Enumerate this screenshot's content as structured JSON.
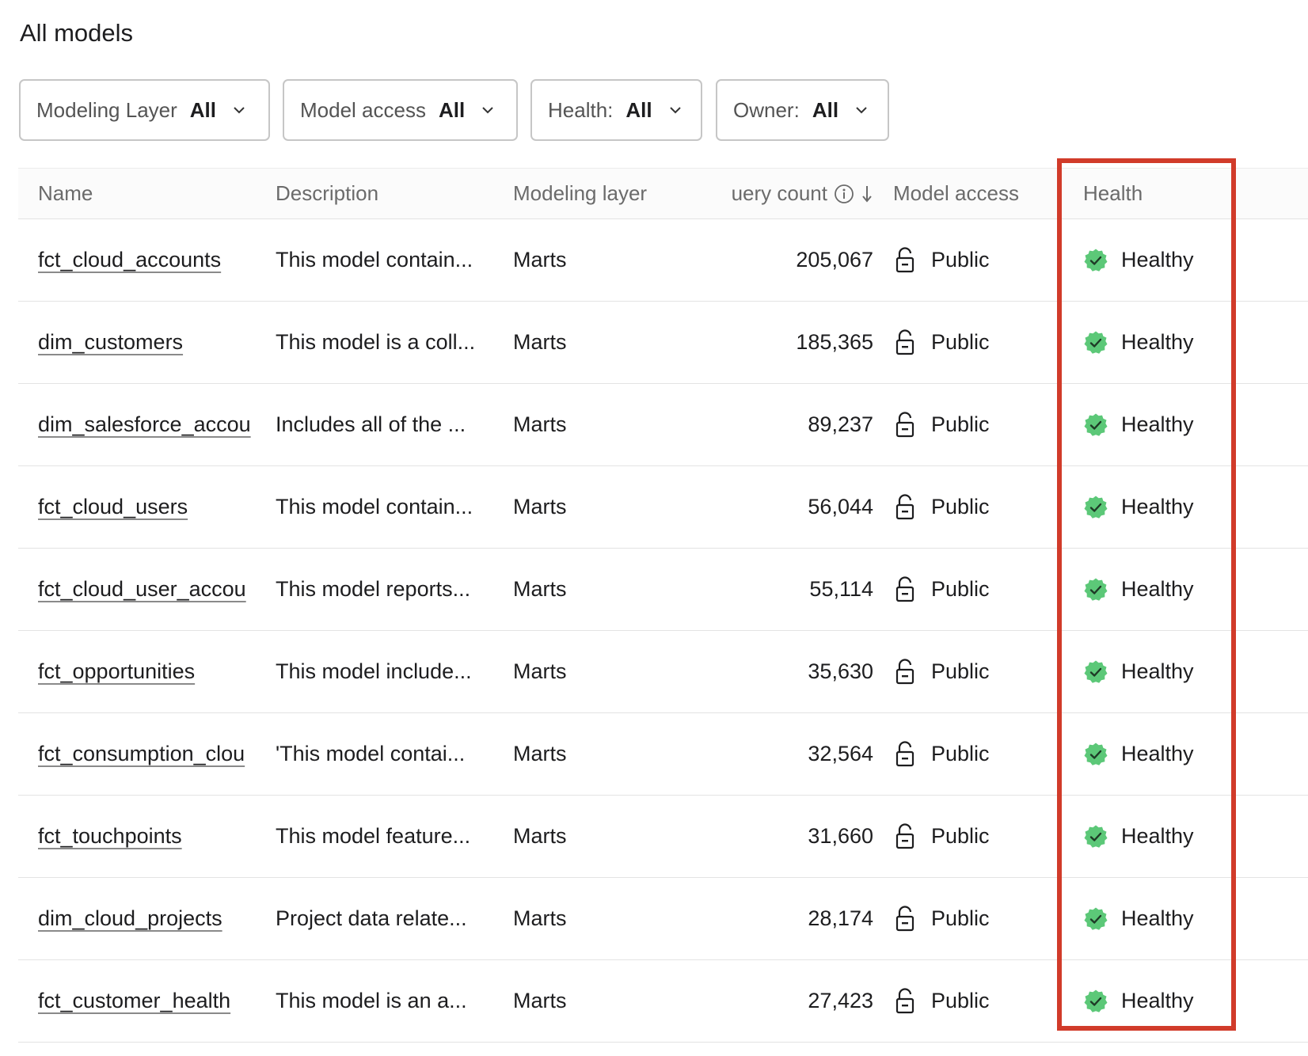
{
  "page": {
    "title": "All models"
  },
  "filters": [
    {
      "label": "Modeling Layer",
      "value": "All"
    },
    {
      "label": "Model access",
      "value": "All"
    },
    {
      "label": "Health:",
      "value": "All"
    },
    {
      "label": "Owner:",
      "value": "All"
    }
  ],
  "table": {
    "columns": {
      "name": "Name",
      "description": "Description",
      "modeling_layer": "Modeling layer",
      "query_count": "Query count",
      "model_access": "Model access",
      "health": "Health"
    },
    "rows": [
      {
        "name": "fct_cloud_accounts",
        "description": "This model contain...",
        "layer": "Marts",
        "count": "205,067",
        "access": "Public",
        "health": "Healthy"
      },
      {
        "name": "dim_customers",
        "description": "This model is a coll...",
        "layer": "Marts",
        "count": "185,365",
        "access": "Public",
        "health": "Healthy"
      },
      {
        "name": "dim_salesforce_accou",
        "description": "Includes all of the ...",
        "layer": "Marts",
        "count": "89,237",
        "access": "Public",
        "health": "Healthy"
      },
      {
        "name": "fct_cloud_users",
        "description": "This model contain...",
        "layer": "Marts",
        "count": "56,044",
        "access": "Public",
        "health": "Healthy"
      },
      {
        "name": "fct_cloud_user_accou",
        "description": "This model reports...",
        "layer": "Marts",
        "count": "55,114",
        "access": "Public",
        "health": "Healthy"
      },
      {
        "name": "fct_opportunities",
        "description": "This model include...",
        "layer": "Marts",
        "count": "35,630",
        "access": "Public",
        "health": "Healthy"
      },
      {
        "name": "fct_consumption_clou",
        "description": "'This model contai...",
        "layer": "Marts",
        "count": "32,564",
        "access": "Public",
        "health": "Healthy"
      },
      {
        "name": "fct_touchpoints",
        "description": "This model feature...",
        "layer": "Marts",
        "count": "31,660",
        "access": "Public",
        "health": "Healthy"
      },
      {
        "name": "dim_cloud_projects",
        "description": "Project data relate...",
        "layer": "Marts",
        "count": "28,174",
        "access": "Public",
        "health": "Healthy"
      },
      {
        "name": "fct_customer_health",
        "description": "This model is an a...",
        "layer": "Marts",
        "count": "27,423",
        "access": "Public",
        "health": "Healthy"
      }
    ]
  },
  "icons": {
    "chevron": "chevron-down-icon",
    "info": "info-icon",
    "sort": "sort-descending-icon",
    "lock": "unlocked-icon",
    "health": "healthy-check-badge-icon"
  },
  "colors": {
    "healthy_green": "#5cc878",
    "highlight_red": "#d13b2a"
  }
}
